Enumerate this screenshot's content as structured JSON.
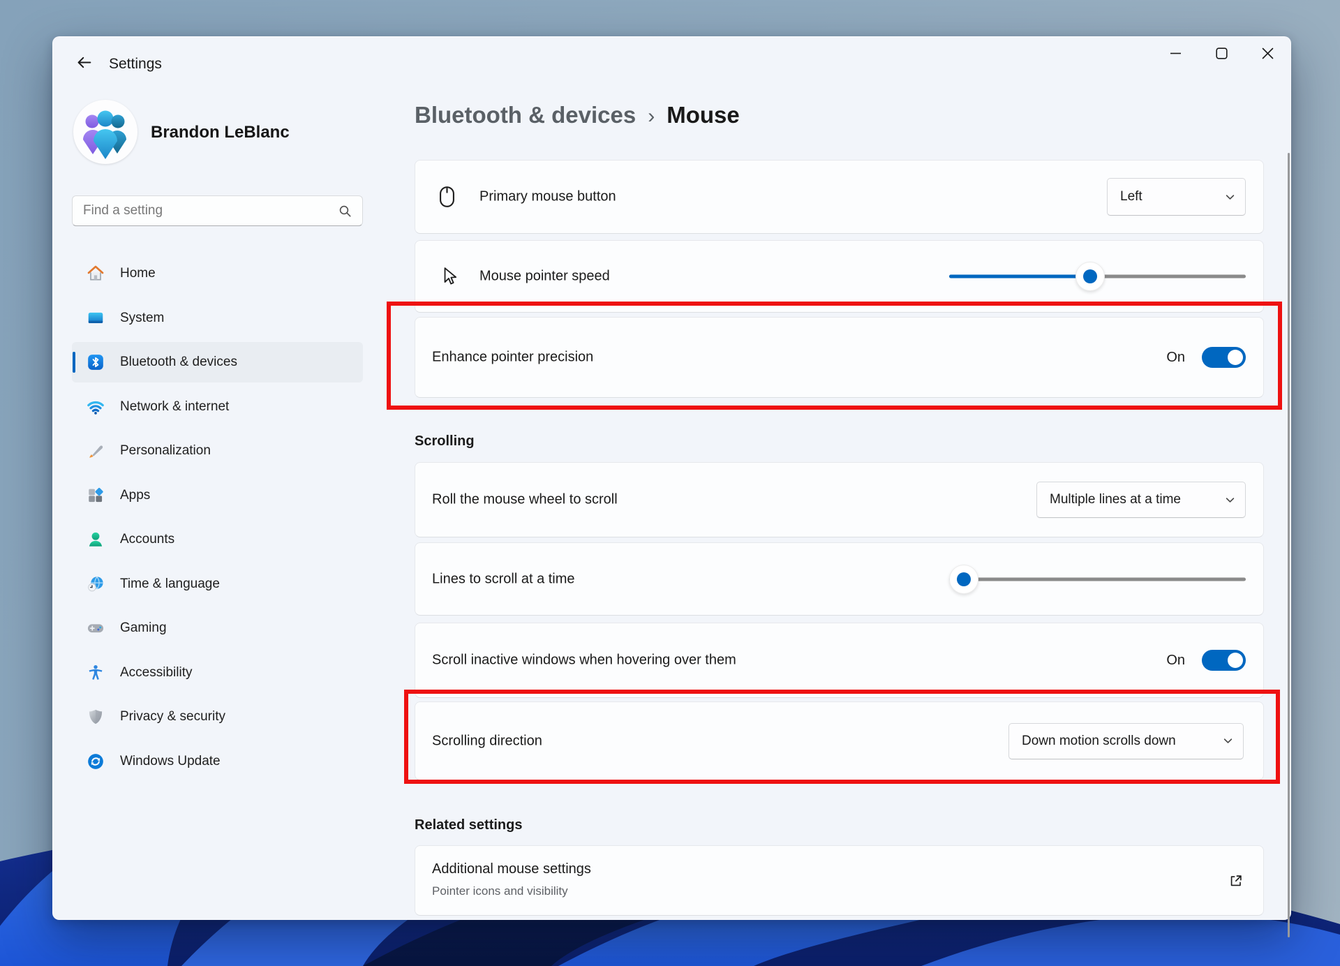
{
  "window": {
    "title": "Settings"
  },
  "user": {
    "name": "Brandon LeBlanc"
  },
  "search": {
    "placeholder": "Find a setting"
  },
  "sidebar": {
    "items": [
      {
        "label": "Home",
        "icon": "home-icon"
      },
      {
        "label": "System",
        "icon": "system-icon"
      },
      {
        "label": "Bluetooth & devices",
        "icon": "bluetooth-icon",
        "selected": true
      },
      {
        "label": "Network & internet",
        "icon": "network-icon"
      },
      {
        "label": "Personalization",
        "icon": "personalization-icon"
      },
      {
        "label": "Apps",
        "icon": "apps-icon"
      },
      {
        "label": "Accounts",
        "icon": "accounts-icon"
      },
      {
        "label": "Time & language",
        "icon": "time-language-icon"
      },
      {
        "label": "Gaming",
        "icon": "gaming-icon"
      },
      {
        "label": "Accessibility",
        "icon": "accessibility-icon"
      },
      {
        "label": "Privacy & security",
        "icon": "privacy-security-icon"
      },
      {
        "label": "Windows Update",
        "icon": "windows-update-icon"
      }
    ]
  },
  "breadcrumb": {
    "parent": "Bluetooth & devices",
    "separator": "›",
    "current": "Mouse"
  },
  "mouse": {
    "primary_button": {
      "label": "Primary mouse button",
      "value": "Left"
    },
    "pointer_speed": {
      "label": "Mouse pointer speed",
      "percent": 47.5
    },
    "enhance_precision": {
      "label": "Enhance pointer precision",
      "state": "On"
    }
  },
  "scrolling": {
    "title": "Scrolling",
    "roll_wheel": {
      "label": "Roll the mouse wheel to scroll",
      "value": "Multiple lines at a time"
    },
    "lines": {
      "label": "Lines to scroll at a time",
      "percent": 5
    },
    "inactive_windows": {
      "label": "Scroll inactive windows when hovering over them",
      "state": "On"
    },
    "direction": {
      "label": "Scrolling direction",
      "value": "Down motion scrolls down"
    }
  },
  "related": {
    "title": "Related settings",
    "additional": {
      "title": "Additional mouse settings",
      "subtitle": "Pointer icons and visibility"
    }
  },
  "colors": {
    "accent": "#0067C0",
    "highlight_red": "#EE1111",
    "slider_track_gray": "#8A8A8A",
    "window_bg": "#F2F5FA"
  }
}
